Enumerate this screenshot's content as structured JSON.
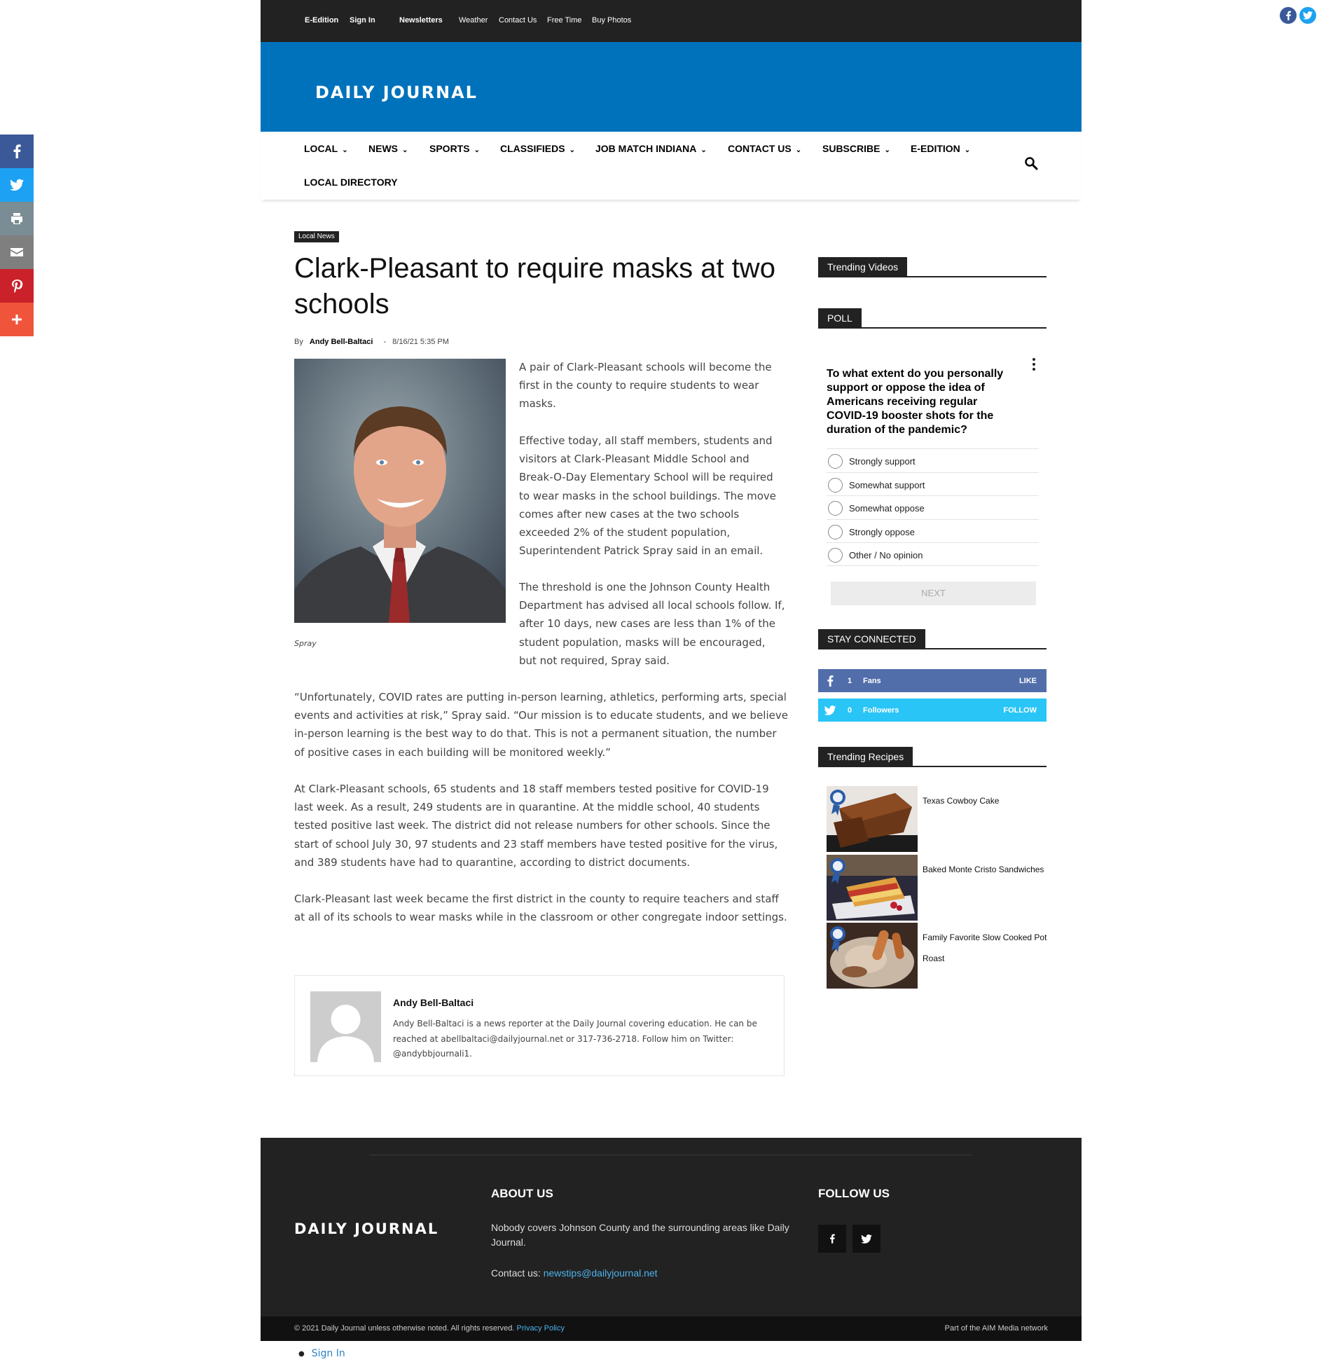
{
  "topbar": {
    "links": [
      "E-Edition",
      "Sign In",
      "Newsletters",
      "Weather",
      "Contact Us",
      "Free Time",
      "Buy Photos"
    ]
  },
  "brand": {
    "logo_text": "DAILY JOURNAL"
  },
  "nav": {
    "items": [
      "LOCAL",
      "NEWS",
      "SPORTS",
      "CLASSIFIEDS",
      "JOB MATCH INDIANA",
      "CONTACT US",
      "SUBSCRIBE",
      "E-EDITION"
    ],
    "local_directory": "LOCAL DIRECTORY"
  },
  "share_sidebar": {
    "buttons": [
      "facebook",
      "twitter",
      "print",
      "email",
      "pinterest",
      "more"
    ],
    "colors": {
      "facebook": "#3b5998",
      "twitter": "#1da1f2",
      "print": "#7a8c94",
      "email": "#7f7f7f",
      "pinterest": "#ca212a",
      "more": "#f0553c"
    }
  },
  "article": {
    "category": "Local News",
    "title": "Clark-Pleasant to require masks at two schools",
    "by": "By",
    "author": "Andy Bell-Baltaci",
    "date": "8/16/21 5:35 PM",
    "image_caption": "Spray",
    "paragraphs": [
      "A pair of Clark-Pleasant schools will become the first in the county to require students to wear masks.",
      "Effective today, all staff members, students and visitors at Clark-Pleasant Middle School and Break-O-Day Elementary School will be required to wear masks in the school buildings. The move comes after new cases at the two schools exceeded 2% of the student population, Superintendent Patrick Spray said in an email.",
      "The threshold is one the Johnson County Health Department has advised all local schools follow. If, after 10 days, new cases are less than 1% of the student population, masks will be encouraged, but not required, Spray said.",
      "“Unfortunately, COVID rates are putting in-person learning, athletics, performing arts, special events and activities at risk,” Spray said. “Our mission is to educate students, and we believe in-person learning is the best way to do that. This is not a permanent situation, the number of positive cases in each building will be monitored weekly.”",
      "At Clark-Pleasant schools, 65 students and 18 staff members tested positive for COVID-19 last week. As a result, 249 students are in quarantine. At the middle school, 40 students tested positive last week. The district did not release numbers for other schools. Since the start of school July 30, 97 students and 23 staff members have tested positive for the virus, and 389 students have had to quarantine, according to district documents.",
      "Clark-Pleasant last week became the first district in the county to require teachers and staff at all of its schools to wear masks while in the classroom or other congregate indoor settings."
    ]
  },
  "author_box": {
    "name": "Andy Bell-Baltaci",
    "bio": "Andy Bell-Baltaci is a news reporter at the Daily Journal covering education. He can be reached at abellbaltaci@dailyjournal.net or 317-736-2718. Follow him on Twitter: @andybbjournali1."
  },
  "sidebar": {
    "trending_videos_title": "Trending Videos",
    "poll_title": "POLL",
    "poll": {
      "question": "To what extent do you personally support or oppose the idea of Americans receiving regular COVID-19 booster shots for the duration of the pandemic?",
      "options": [
        "Strongly support",
        "Somewhat support",
        "Somewhat oppose",
        "Strongly oppose",
        "Other / No opinion"
      ],
      "next_label": "NEXT"
    },
    "stay_connected_title": "STAY CONNECTED",
    "social": [
      {
        "count": "1",
        "label": "Fans",
        "action": "LIKE",
        "color": "#516eab"
      },
      {
        "count": "0",
        "label": "Followers",
        "action": "FOLLOW",
        "color": "#29c5f6"
      }
    ],
    "trending_recipes_title": "Trending Recipes",
    "recipes": [
      "Texas Cowboy Cake",
      "Baked Monte Cristo Sandwiches",
      "Family Favorite Slow Cooked Pot Roast"
    ]
  },
  "footer": {
    "logo_text": "DAILY JOURNAL",
    "about_heading": "ABOUT US",
    "about_text": "Nobody covers Johnson County and the surrounding areas like Daily Journal.",
    "contact_label": "Contact us:",
    "contact_email": "newstips@dailyjournal.net",
    "follow_heading": "FOLLOW US",
    "copyright": "© 2021 Daily Journal unless otherwise noted. All rights reserved.",
    "privacy": "Privacy Policy",
    "network": "Part of the AIM Media network"
  },
  "bottom": {
    "sign_in": "Sign In"
  }
}
